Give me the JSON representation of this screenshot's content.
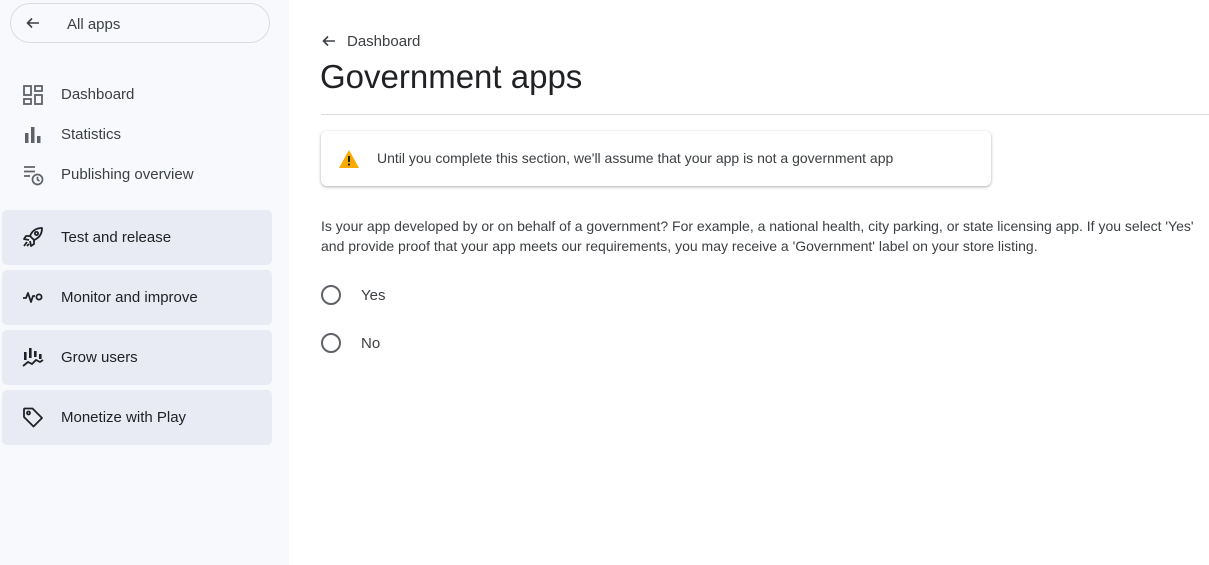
{
  "sidebar": {
    "all_apps_label": "All apps",
    "nav_items": [
      {
        "label": "Dashboard",
        "icon": "dashboard-icon"
      },
      {
        "label": "Statistics",
        "icon": "bar-chart-icon"
      },
      {
        "label": "Publishing overview",
        "icon": "publishing-overview-icon"
      }
    ],
    "groups": [
      {
        "label": "Test and release",
        "icon": "rocket-icon"
      },
      {
        "label": "Monitor and improve",
        "icon": "vitals-icon"
      },
      {
        "label": "Grow users",
        "icon": "grow-users-icon"
      },
      {
        "label": "Monetize with Play",
        "icon": "tag-icon"
      }
    ]
  },
  "main": {
    "breadcrumb": "Dashboard",
    "title": "Government apps",
    "warning": "Until you complete this section, we'll assume that your app is not a government app",
    "description": [
      "Is your app developed by or on behalf of a government? For example, a national health, city parking, or state licensing app. If you select 'Yes'",
      "and provide proof that your app meets our requirements, you may receive a 'Government' label on your store listing."
    ],
    "options": [
      "Yes",
      "No"
    ]
  },
  "colors": {
    "sidebar_bg": "#f8f9fc",
    "group_bg": "#e8ebf4",
    "warning_icon": "#f9ab00"
  }
}
